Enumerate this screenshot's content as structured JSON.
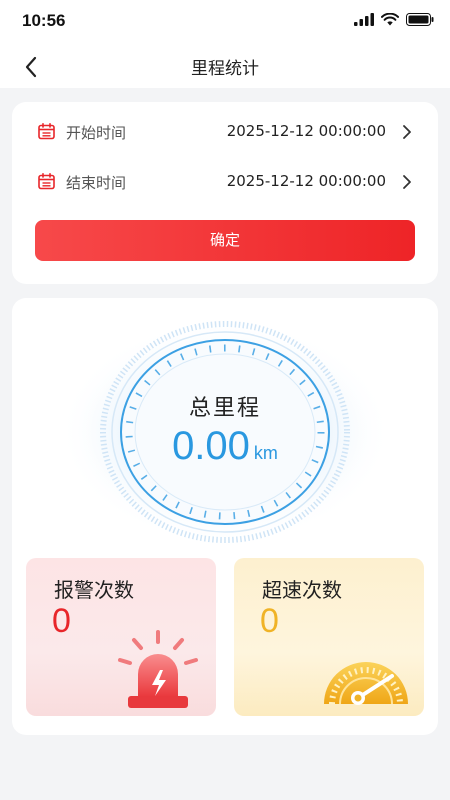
{
  "status_bar": {
    "time": "10:56"
  },
  "nav": {
    "title": "里程统计"
  },
  "date_filter": {
    "start_label": "开始时间",
    "start_value": "2025-12-12 00:00:00",
    "end_label": "结束时间",
    "end_value": "2025-12-12 00:00:00",
    "confirm_label": "确定"
  },
  "mileage": {
    "title": "总里程",
    "value": "0.00",
    "unit": "km"
  },
  "stats": {
    "alarm": {
      "label": "报警次数",
      "count": "0"
    },
    "overspeed": {
      "label": "超速次数",
      "count": "0"
    }
  },
  "colors": {
    "accent_red": "#ee2427",
    "gauge_blue": "#2a98e0",
    "alarm_red": "#e8262a",
    "speed_yellow": "#f0b326"
  }
}
